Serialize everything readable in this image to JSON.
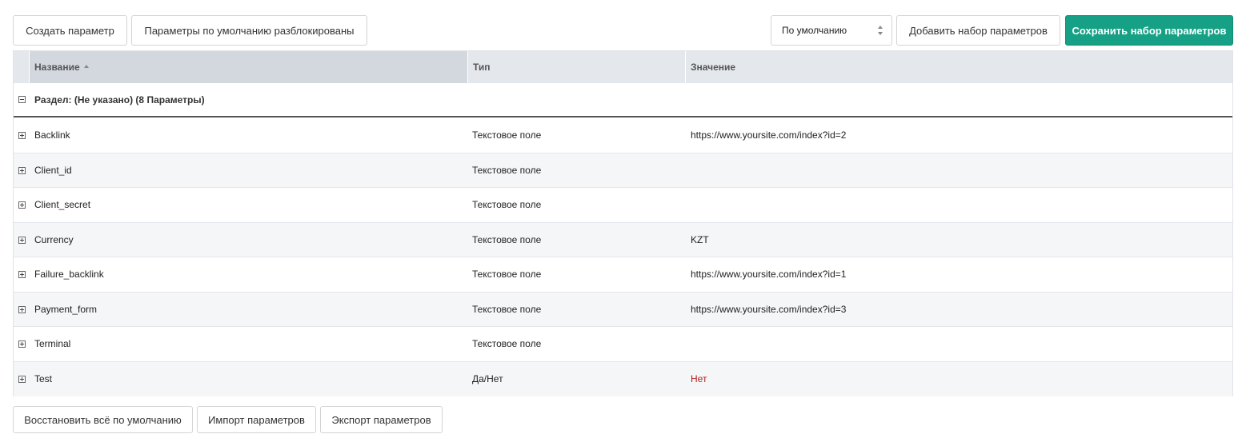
{
  "toolbar": {
    "create_param": "Создать параметр",
    "defaults_unlocked": "Параметры по умолчанию разблокированы",
    "preset_select": "По умолчанию",
    "add_set": "Добавить набор параметров",
    "save_set": "Сохранить набор параметров"
  },
  "grid": {
    "columns": {
      "name": "Название",
      "type": "Тип",
      "value": "Значение"
    },
    "group_label": "Раздел: (Не указано) (8 Параметры)",
    "rows": [
      {
        "name": "Backlink",
        "type": "Текстовое поле",
        "value": "https://www.yoursite.com/index?id=2"
      },
      {
        "name": "Client_id",
        "type": "Текстовое поле",
        "value": ""
      },
      {
        "name": "Client_secret",
        "type": "Текстовое поле",
        "value": ""
      },
      {
        "name": "Currency",
        "type": "Текстовое поле",
        "value": "KZT"
      },
      {
        "name": "Failure_backlink",
        "type": "Текстовое поле",
        "value": "https://www.yoursite.com/index?id=1"
      },
      {
        "name": "Payment_form",
        "type": "Текстовое поле",
        "value": "https://www.yoursite.com/index?id=3"
      },
      {
        "name": "Terminal",
        "type": "Текстовое поле",
        "value": ""
      },
      {
        "name": "Test",
        "type": "Да/Нет",
        "value": "Нет"
      }
    ]
  },
  "footer": {
    "restore_defaults": "Восстановить всё по умолчанию",
    "import": "Импорт параметров",
    "export": "Экспорт параметров"
  },
  "colors": {
    "primary": "#16a085",
    "no_value": "#b52020",
    "header_bg": "#e4e7ec"
  }
}
